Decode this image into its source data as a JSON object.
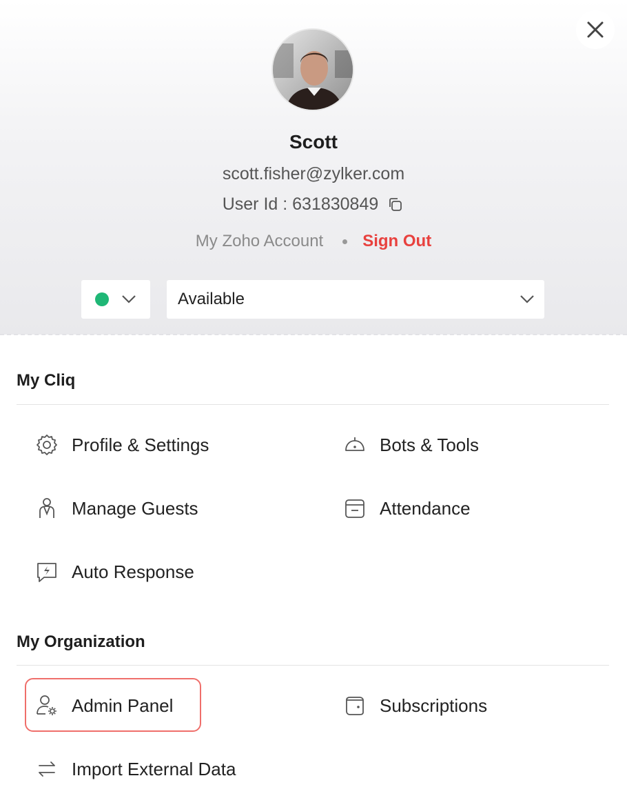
{
  "profile": {
    "name": "Scott",
    "email": "scott.fisher@zylker.com",
    "user_id_label": "User Id : 631830849",
    "my_account_link": "My Zoho Account",
    "sign_out_link": "Sign Out",
    "status_color": "#1fb776",
    "status_text": "Available"
  },
  "sections": {
    "my_cliq": {
      "title": "My Cliq",
      "items": [
        {
          "label": "Profile & Settings",
          "icon": "gear-icon"
        },
        {
          "label": "Bots & Tools",
          "icon": "bot-icon"
        },
        {
          "label": "Manage Guests",
          "icon": "guest-icon"
        },
        {
          "label": "Attendance",
          "icon": "calendar-icon"
        },
        {
          "label": "Auto Response",
          "icon": "chat-bolt-icon"
        }
      ]
    },
    "my_org": {
      "title": "My Organization",
      "items": [
        {
          "label": "Admin Panel",
          "icon": "admin-icon"
        },
        {
          "label": "Subscriptions",
          "icon": "wallet-icon"
        },
        {
          "label": "Import External Data",
          "icon": "swap-arrows-icon"
        }
      ]
    }
  },
  "colors": {
    "accent_red": "#e8413e",
    "highlight": "#ef6e6a",
    "status_green": "#1fb776"
  }
}
